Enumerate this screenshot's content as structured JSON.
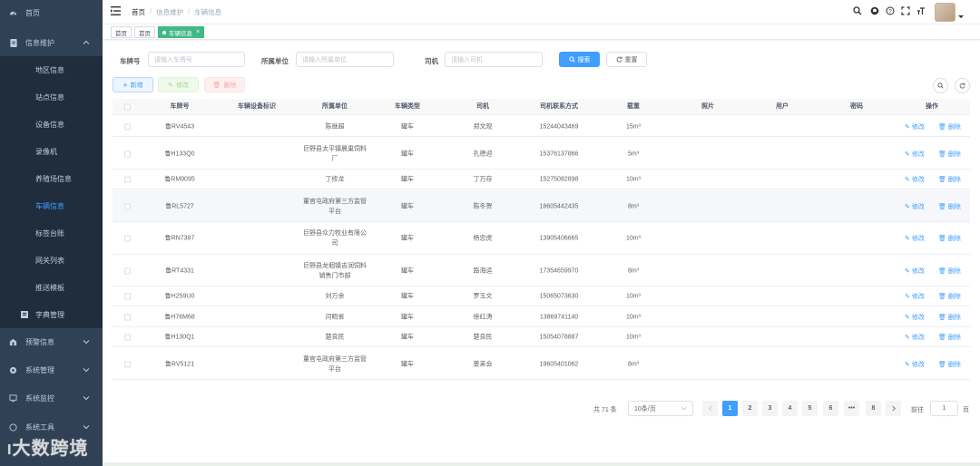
{
  "sidebar": {
    "items": [
      {
        "label": "首页",
        "icon": "dashboard-icon"
      },
      {
        "label": "信息维护",
        "icon": "document-icon",
        "expanded": true
      },
      {
        "label": "地区信息"
      },
      {
        "label": "站点信息"
      },
      {
        "label": "设备信息"
      },
      {
        "label": "录像机"
      },
      {
        "label": "养殖场信息"
      },
      {
        "label": "车辆信息",
        "active": true
      },
      {
        "label": "标签台账"
      },
      {
        "label": "网关列表"
      },
      {
        "label": "推送模板"
      },
      {
        "label": "字典管理",
        "icon": "dict-icon"
      },
      {
        "label": "预警信息",
        "icon": "warning-icon"
      },
      {
        "label": "系统管理",
        "icon": "gear-icon"
      },
      {
        "label": "系统监控",
        "icon": "monitor-icon"
      },
      {
        "label": "系统工具",
        "icon": "tool-icon"
      }
    ],
    "watermark": "大数跨境"
  },
  "navbar": {
    "breadcrumb": [
      "首页",
      "信息维护",
      "车辆信息"
    ],
    "separator": "/"
  },
  "tags": {
    "home1": "首页",
    "home2": "首页",
    "current": "车辆信息",
    "close": "×"
  },
  "search": {
    "plate_label": "车牌号",
    "plate_placeholder": "请输入车牌号",
    "unit_label": "所属单位",
    "unit_placeholder": "请输入所属单位",
    "driver_label": "司机",
    "driver_placeholder": "请输入司机",
    "search_btn": "搜索",
    "reset_btn": "重置"
  },
  "toolbar": {
    "add": "新增",
    "edit": "修改",
    "delete": "删除"
  },
  "table": {
    "headers": [
      "车牌号",
      "车辆设备标识",
      "所属单位",
      "车辆类型",
      "司机",
      "司机联系方式",
      "载重",
      "照片",
      "用户",
      "密码",
      "操作"
    ],
    "rows": [
      {
        "plate": "鲁RV4543",
        "unit": "陈继超",
        "type": "罐车",
        "driver": "郑文现",
        "phone": "15244043469",
        "load": "15m³"
      },
      {
        "plate": "鲁H133Q0",
        "unit": "巨野县太平镇晨巢饲料厂",
        "type": "罐车",
        "driver": "孔德迎",
        "phone": "15376137866",
        "load": "5m³"
      },
      {
        "plate": "鲁RM9095",
        "unit": "丁修龙",
        "type": "罐车",
        "driver": "丁万存",
        "phone": "15275082898",
        "load": "10m³"
      },
      {
        "plate": "鲁RL5727",
        "unit": "董官屯政府第三方监管平台",
        "type": "罐车",
        "driver": "陈冬贺",
        "phone": "18605442435",
        "load": "8m³"
      },
      {
        "plate": "鲁RN7397",
        "unit": "巨野县众力牧业有限公司",
        "type": "罐车",
        "driver": "杨忠虎",
        "phone": "13905406665",
        "load": "10m³"
      },
      {
        "plate": "鲁RT4331",
        "unit": "巨野县龙堌镇吉润饲料销售门市部",
        "type": "罐车",
        "driver": "路海运",
        "phone": "17354659970",
        "load": "8m³"
      },
      {
        "plate": "鲁H259U0",
        "unit": "刘万余",
        "type": "罐车",
        "driver": "罗玉文",
        "phone": "15065073630",
        "load": "10m³"
      },
      {
        "plate": "鲁H76M68",
        "unit": "闫昭省",
        "type": "罐车",
        "driver": "徐红涛",
        "phone": "13869741140",
        "load": "10m³"
      },
      {
        "plate": "鲁H130Q1",
        "unit": "楚良民",
        "type": "罐车",
        "driver": "楚良民",
        "phone": "15054078887",
        "load": "10m³"
      },
      {
        "plate": "鲁RV5121",
        "unit": "董官屯政府第三方监管平台",
        "type": "罐车",
        "driver": "姜来会",
        "phone": "19605401062",
        "load": "8m³"
      }
    ],
    "edit_label": "修改",
    "delete_label": "删除"
  },
  "pagination": {
    "total": "共 71 条",
    "page_size": "10条/页",
    "pages": [
      "1",
      "2",
      "3",
      "4",
      "5",
      "6",
      "•••",
      "8"
    ],
    "current": "1",
    "goto_label": "前往",
    "goto_value": "1",
    "goto_suffix": "页"
  }
}
